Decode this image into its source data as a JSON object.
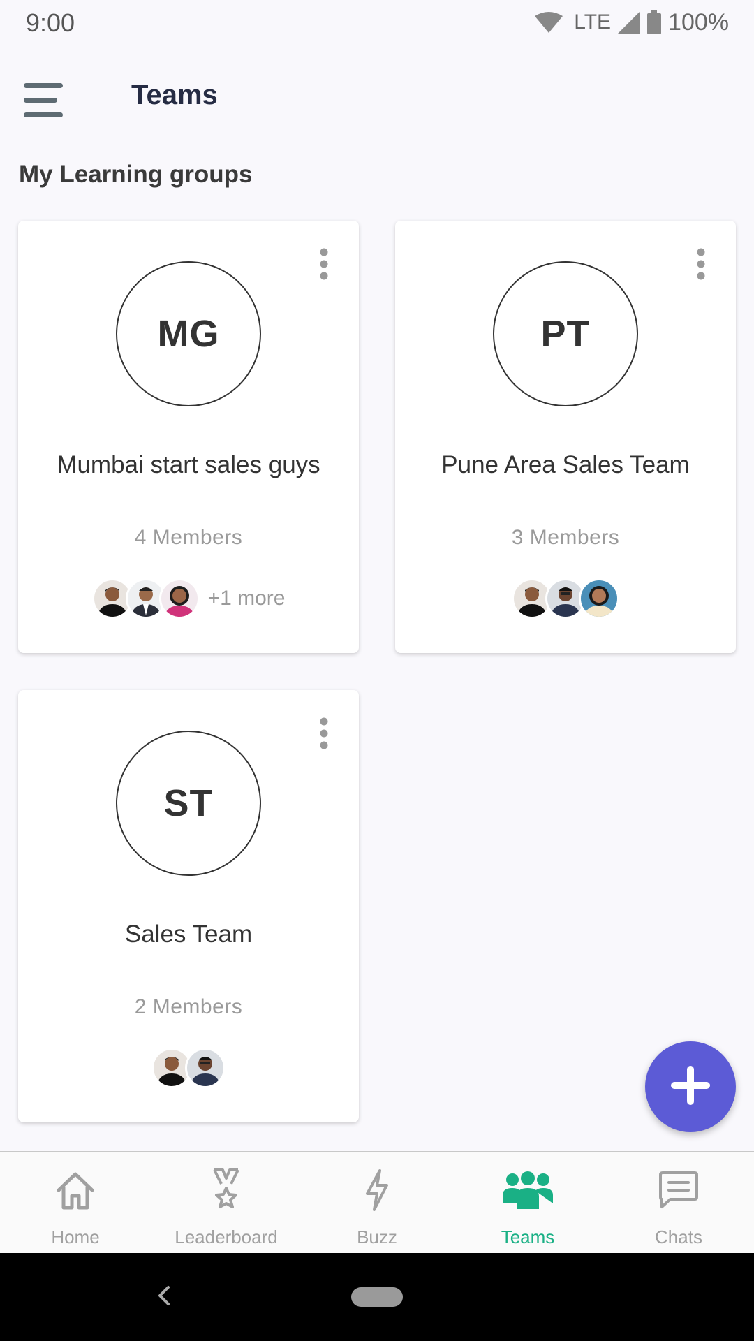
{
  "status_bar": {
    "time": "9:00",
    "network": "LTE",
    "battery": "100%"
  },
  "app_bar": {
    "title": "Teams",
    "menu_icon": "hamburger-menu-icon"
  },
  "section_title": "My Learning groups",
  "groups": [
    {
      "initials": "MG",
      "name": "Mumbai start sales guys",
      "members": "4 Members",
      "more": "+1 more"
    },
    {
      "initials": "PT",
      "name": "Pune Area Sales Team",
      "members": "3 Members"
    },
    {
      "initials": "ST",
      "name": "Sales Team",
      "members": "2 Members"
    }
  ],
  "fab": {
    "icon": "plus-icon",
    "color": "#5c5bd6"
  },
  "bottom_nav": {
    "items": [
      {
        "label": "Home",
        "icon": "home-icon"
      },
      {
        "label": "Leaderboard",
        "icon": "medal-icon"
      },
      {
        "label": "Buzz",
        "icon": "lightning-icon"
      },
      {
        "label": "Teams",
        "icon": "people-icon",
        "active": true
      },
      {
        "label": "Chats",
        "icon": "chat-icon"
      }
    ],
    "active_color": "#1ab085",
    "inactive_color": "#a0a0a0"
  }
}
